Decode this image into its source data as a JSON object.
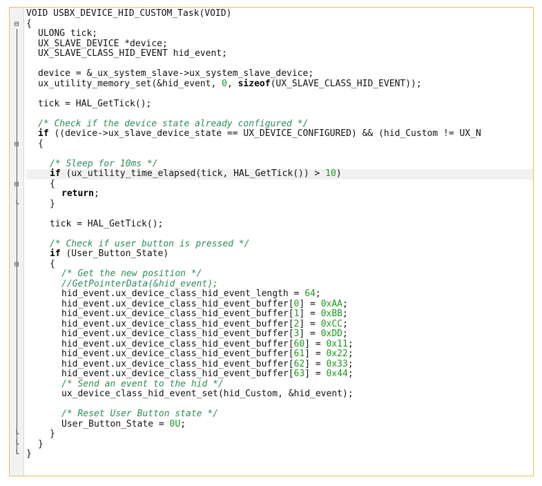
{
  "code_lines": [
    {
      "indent": 0,
      "fold": "",
      "tokens": [
        {
          "t": "VOID USBX_DEVICE_HID_CUSTOM_Task(VOID)",
          "c": "tx"
        }
      ]
    },
    {
      "indent": 0,
      "fold": "minus",
      "tokens": [
        {
          "t": "{",
          "c": "tx"
        }
      ]
    },
    {
      "indent": 1,
      "fold": "",
      "tokens": [
        {
          "t": "ULONG tick;",
          "c": "tx"
        }
      ]
    },
    {
      "indent": 1,
      "fold": "",
      "tokens": [
        {
          "t": "UX_SLAVE_DEVICE *device;",
          "c": "tx"
        }
      ]
    },
    {
      "indent": 1,
      "fold": "",
      "tokens": [
        {
          "t": "UX_SLAVE_CLASS_HID_EVENT hid_event;",
          "c": "tx"
        }
      ]
    },
    {
      "indent": 1,
      "fold": "",
      "tokens": []
    },
    {
      "indent": 1,
      "fold": "",
      "tokens": [
        {
          "t": "device = &_ux_system_slave->ux_system_slave_device;",
          "c": "tx"
        }
      ]
    },
    {
      "indent": 1,
      "fold": "",
      "tokens": [
        {
          "t": "ux_utility_memory_set(&hid_event, ",
          "c": "tx"
        },
        {
          "t": "0",
          "c": "num"
        },
        {
          "t": ", ",
          "c": "tx"
        },
        {
          "t": "sizeof",
          "c": "kw"
        },
        {
          "t": "(UX_SLAVE_CLASS_HID_EVENT));",
          "c": "tx"
        }
      ]
    },
    {
      "indent": 1,
      "fold": "",
      "tokens": []
    },
    {
      "indent": 1,
      "fold": "",
      "tokens": [
        {
          "t": "tick = HAL_GetTick();",
          "c": "tx"
        }
      ]
    },
    {
      "indent": 1,
      "fold": "",
      "tokens": []
    },
    {
      "indent": 1,
      "fold": "",
      "tokens": [
        {
          "t": "/* Check if the device state already configured */",
          "c": "cm"
        }
      ]
    },
    {
      "indent": 1,
      "fold": "",
      "tokens": [
        {
          "t": "if",
          "c": "kw"
        },
        {
          "t": " ((device->ux_slave_device_state == UX_DEVICE_CONFIGURED) && (hid_Custom != UX_N",
          "c": "tx"
        }
      ]
    },
    {
      "indent": 1,
      "fold": "minus",
      "tokens": [
        {
          "t": "{",
          "c": "tx"
        }
      ]
    },
    {
      "indent": 1,
      "fold": "",
      "tokens": []
    },
    {
      "indent": 2,
      "fold": "",
      "tokens": [
        {
          "t": "/* Sleep for 10ms */",
          "c": "cm"
        }
      ]
    },
    {
      "indent": 2,
      "fold": "",
      "highlight": true,
      "tokens": [
        {
          "t": "if",
          "c": "kw"
        },
        {
          "t": " (ux_utility_time_elapsed(tick, HAL_GetTick()) > ",
          "c": "tx"
        },
        {
          "t": "10",
          "c": "num"
        },
        {
          "t": ")",
          "c": "tx"
        }
      ]
    },
    {
      "indent": 2,
      "fold": "minus",
      "tokens": [
        {
          "t": "{",
          "c": "tx"
        }
      ]
    },
    {
      "indent": 3,
      "fold": "",
      "tokens": [
        {
          "t": "return",
          "c": "kw"
        },
        {
          "t": ";",
          "c": "tx"
        }
      ]
    },
    {
      "indent": 2,
      "fold": "end",
      "tokens": [
        {
          "t": "}",
          "c": "tx"
        }
      ]
    },
    {
      "indent": 2,
      "fold": "",
      "tokens": []
    },
    {
      "indent": 2,
      "fold": "",
      "tokens": [
        {
          "t": "tick = HAL_GetTick();",
          "c": "tx"
        }
      ]
    },
    {
      "indent": 2,
      "fold": "",
      "tokens": []
    },
    {
      "indent": 2,
      "fold": "",
      "tokens": [
        {
          "t": "/* Check if user button is pressed */",
          "c": "cm"
        }
      ]
    },
    {
      "indent": 2,
      "fold": "",
      "tokens": [
        {
          "t": "if",
          "c": "kw"
        },
        {
          "t": " (User_Button_State)",
          "c": "tx"
        }
      ]
    },
    {
      "indent": 2,
      "fold": "minus",
      "tokens": [
        {
          "t": "{",
          "c": "tx"
        }
      ]
    },
    {
      "indent": 3,
      "fold": "",
      "tokens": [
        {
          "t": "/* Get the new position */",
          "c": "cm"
        }
      ]
    },
    {
      "indent": 3,
      "fold": "",
      "tokens": [
        {
          "t": "//GetPointerData(&hid_event);",
          "c": "cm"
        }
      ]
    },
    {
      "indent": 3,
      "fold": "",
      "tokens": [
        {
          "t": "hid_event.ux_device_class_hid_event_length = ",
          "c": "tx"
        },
        {
          "t": "64",
          "c": "num"
        },
        {
          "t": ";",
          "c": "tx"
        }
      ]
    },
    {
      "indent": 3,
      "fold": "",
      "tokens": [
        {
          "t": "hid_event.ux_device_class_hid_event_buffer[",
          "c": "tx"
        },
        {
          "t": "0",
          "c": "num"
        },
        {
          "t": "] = ",
          "c": "tx"
        },
        {
          "t": "0xAA",
          "c": "num"
        },
        {
          "t": ";",
          "c": "tx"
        }
      ]
    },
    {
      "indent": 3,
      "fold": "",
      "tokens": [
        {
          "t": "hid_event.ux_device_class_hid_event_buffer[",
          "c": "tx"
        },
        {
          "t": "1",
          "c": "num"
        },
        {
          "t": "] = ",
          "c": "tx"
        },
        {
          "t": "0xBB",
          "c": "num"
        },
        {
          "t": ";",
          "c": "tx"
        }
      ]
    },
    {
      "indent": 3,
      "fold": "",
      "tokens": [
        {
          "t": "hid_event.ux_device_class_hid_event_buffer[",
          "c": "tx"
        },
        {
          "t": "2",
          "c": "num"
        },
        {
          "t": "] = ",
          "c": "tx"
        },
        {
          "t": "0xCC",
          "c": "num"
        },
        {
          "t": ";",
          "c": "tx"
        }
      ]
    },
    {
      "indent": 3,
      "fold": "",
      "tokens": [
        {
          "t": "hid_event.ux_device_class_hid_event_buffer[",
          "c": "tx"
        },
        {
          "t": "3",
          "c": "num"
        },
        {
          "t": "] = ",
          "c": "tx"
        },
        {
          "t": "0xDD",
          "c": "num"
        },
        {
          "t": ";",
          "c": "tx"
        }
      ]
    },
    {
      "indent": 3,
      "fold": "",
      "tokens": [
        {
          "t": "hid_event.ux_device_class_hid_event_buffer[",
          "c": "tx"
        },
        {
          "t": "60",
          "c": "num"
        },
        {
          "t": "] = ",
          "c": "tx"
        },
        {
          "t": "0x11",
          "c": "num"
        },
        {
          "t": ";",
          "c": "tx"
        }
      ]
    },
    {
      "indent": 3,
      "fold": "",
      "tokens": [
        {
          "t": "hid_event.ux_device_class_hid_event_buffer[",
          "c": "tx"
        },
        {
          "t": "61",
          "c": "num"
        },
        {
          "t": "] = ",
          "c": "tx"
        },
        {
          "t": "0x22",
          "c": "num"
        },
        {
          "t": ";",
          "c": "tx"
        }
      ]
    },
    {
      "indent": 3,
      "fold": "",
      "tokens": [
        {
          "t": "hid_event.ux_device_class_hid_event_buffer[",
          "c": "tx"
        },
        {
          "t": "62",
          "c": "num"
        },
        {
          "t": "] = ",
          "c": "tx"
        },
        {
          "t": "0x33",
          "c": "num"
        },
        {
          "t": ";",
          "c": "tx"
        }
      ]
    },
    {
      "indent": 3,
      "fold": "",
      "tokens": [
        {
          "t": "hid_event.ux_device_class_hid_event_buffer[",
          "c": "tx"
        },
        {
          "t": "63",
          "c": "num"
        },
        {
          "t": "] = ",
          "c": "tx"
        },
        {
          "t": "0x44",
          "c": "num"
        },
        {
          "t": ";",
          "c": "tx"
        }
      ]
    },
    {
      "indent": 3,
      "fold": "",
      "tokens": [
        {
          "t": "/* Send an event to the hid */",
          "c": "cm"
        }
      ]
    },
    {
      "indent": 3,
      "fold": "",
      "tokens": [
        {
          "t": "ux_device_class_hid_event_set(hid_Custom, &hid_event);",
          "c": "tx"
        }
      ]
    },
    {
      "indent": 3,
      "fold": "",
      "tokens": []
    },
    {
      "indent": 3,
      "fold": "",
      "tokens": [
        {
          "t": "/* Reset User Button state */",
          "c": "cm"
        }
      ]
    },
    {
      "indent": 3,
      "fold": "",
      "tokens": [
        {
          "t": "User_Button_State = ",
          "c": "tx"
        },
        {
          "t": "0U",
          "c": "num"
        },
        {
          "t": ";",
          "c": "tx"
        }
      ]
    },
    {
      "indent": 2,
      "fold": "end",
      "tokens": [
        {
          "t": "}",
          "c": "tx"
        }
      ]
    },
    {
      "indent": 1,
      "fold": "end",
      "tokens": [
        {
          "t": "}",
          "c": "tx"
        }
      ]
    },
    {
      "indent": 0,
      "fold": "end",
      "tokens": [
        {
          "t": "}",
          "c": "tx"
        }
      ]
    }
  ]
}
